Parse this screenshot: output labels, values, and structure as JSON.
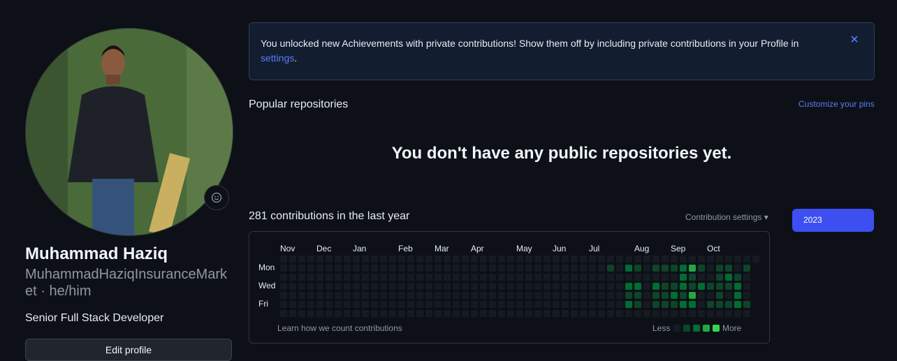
{
  "profile": {
    "name": "Muhammad Haziq",
    "login_pronouns": "MuhammadHaziqInsuranceMarket · he/him",
    "bio": "Senior Full Stack Developer",
    "edit_label": "Edit profile",
    "status_icon": "smiley-icon"
  },
  "flash": {
    "message": "You unlocked new Achievements with private contributions! Show them off by including private contributions in your Profile in",
    "link_text": "settings",
    "suffix": ".",
    "close_icon": "close-icon"
  },
  "popular": {
    "heading": "Popular repositories",
    "customize_label": "Customize your pins",
    "empty_message": "You don't have any public repositories yet."
  },
  "contributions": {
    "title": "281 contributions in the last year",
    "settings_label": "Contribution settings",
    "year": "2023",
    "months": [
      "Nov",
      "Dec",
      "Jan",
      "Feb",
      "Mar",
      "Apr",
      "May",
      "Jun",
      "Jul",
      "Aug",
      "Sep",
      "Oct"
    ],
    "days": [
      "Mon",
      "Wed",
      "Fri"
    ],
    "learn_label": "Learn how we count contributions",
    "legend_less": "Less",
    "legend_more": "More",
    "level_colors": [
      "#161b22",
      "#0e4429",
      "#006d32",
      "#26a641",
      "#39d353"
    ],
    "weeks": 53,
    "active_weeks": {
      "36": [
        0,
        1,
        0,
        0,
        0,
        0,
        0
      ],
      "38": [
        0,
        2,
        0,
        2,
        1,
        2,
        0
      ],
      "39": [
        0,
        1,
        0,
        2,
        1,
        1,
        0
      ],
      "40": [
        0,
        0,
        0,
        0,
        0,
        0,
        0
      ],
      "41": [
        0,
        1,
        0,
        2,
        1,
        1,
        0
      ],
      "42": [
        0,
        1,
        0,
        1,
        1,
        1,
        0
      ],
      "43": [
        0,
        1,
        0,
        1,
        2,
        1,
        0
      ],
      "44": [
        0,
        2,
        2,
        2,
        1,
        2,
        0
      ],
      "45": [
        0,
        3,
        1,
        1,
        3,
        2,
        0
      ],
      "46": [
        0,
        1,
        0,
        2,
        0,
        0,
        0
      ],
      "47": [
        0,
        0,
        0,
        1,
        0,
        1,
        0
      ],
      "48": [
        0,
        1,
        1,
        1,
        1,
        1,
        0
      ],
      "49": [
        0,
        1,
        2,
        1,
        0,
        1,
        0
      ],
      "50": [
        0,
        0,
        1,
        2,
        2,
        2,
        0
      ],
      "51": [
        0,
        1,
        0,
        0,
        0,
        1,
        0
      ]
    }
  }
}
